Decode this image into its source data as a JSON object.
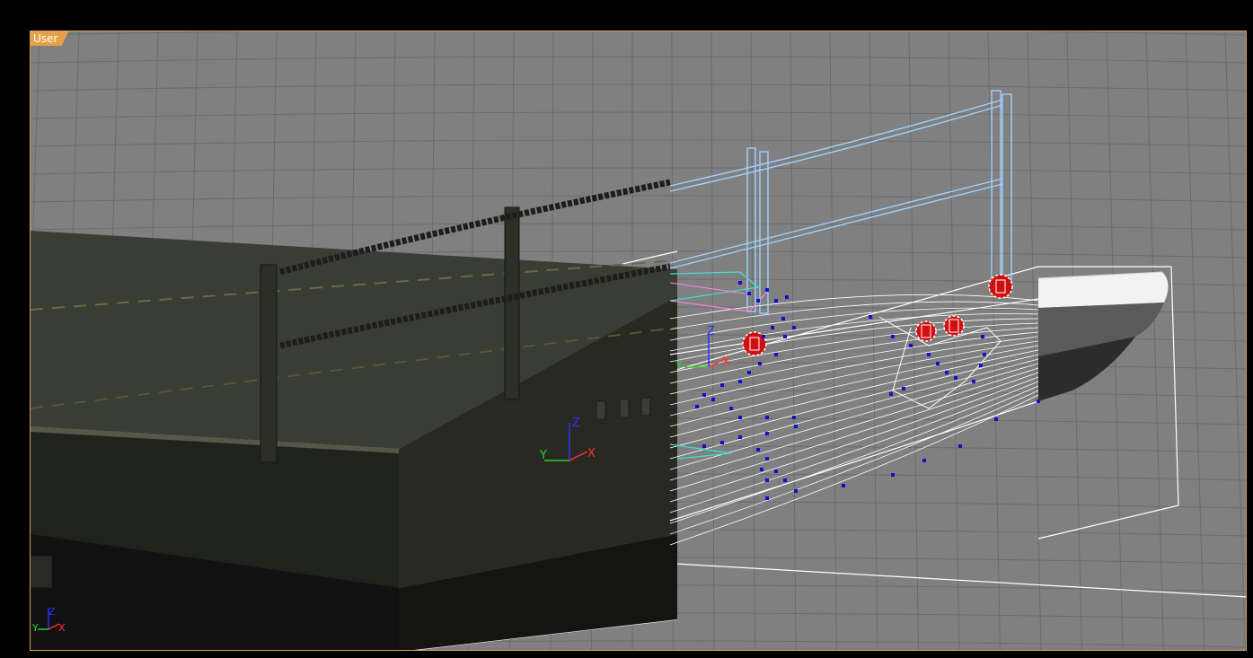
{
  "viewport": {
    "label": "User",
    "border_color": "#d9a060",
    "label_color": "#e6a24a"
  },
  "colors": {
    "grid_background": "#808080",
    "grid_line": "#6c6c6c",
    "wireframe": "#ffffff",
    "selected_wire": "#9fd0ff",
    "vertex": "#1010d0",
    "axis_x": "#ff3030",
    "axis_y": "#30d030",
    "axis_z": "#3030ff"
  },
  "gizmo_main": {
    "x": "X",
    "y": "Y",
    "z": "Z"
  },
  "gizmo_pivot": {
    "x": "X",
    "y": "Y",
    "z": "Z"
  },
  "gizmo_corner": {
    "x": "X",
    "y": "Y",
    "z": "Z"
  },
  "icons": [
    "world-axis-tripod-icon",
    "transform-gizmo-icon"
  ]
}
